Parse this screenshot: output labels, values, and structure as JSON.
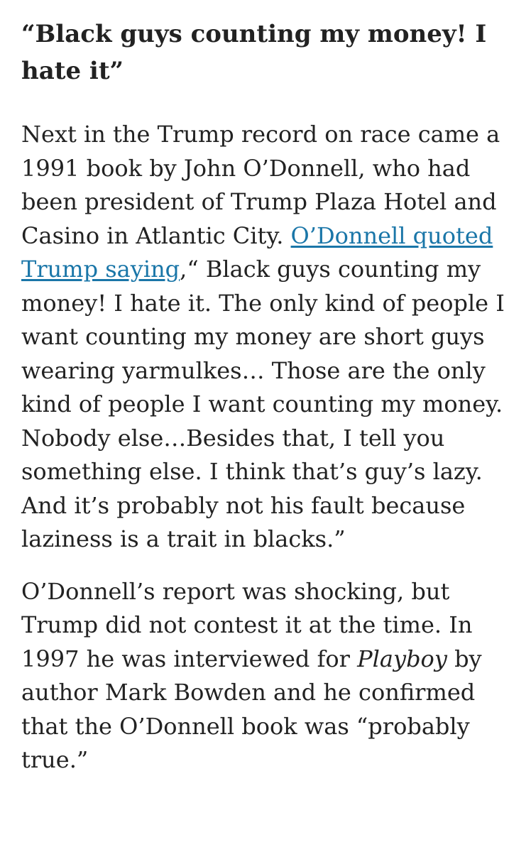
{
  "article": {
    "heading": "“Black guys counting my money! I hate it”",
    "paragraph1": {
      "before_link": "Next in the Trump record on race came a 1991 book by John O’Donnell, who had been president of Trump Plaza Hotel and Casino in Atlantic City. ",
      "link_text": "O’Donnell quoted Trump saying",
      "after_link": ",“ Black guys counting my money! I hate it. The only kind of people I want counting my money are short guys wearing yarmulkes… Those are the only kind of people I want counting my money. Nobody else…Besides that, I tell you something else. I think that’s guy’s lazy. And it’s probably not his fault because laziness is a trait in blacks.”"
    },
    "paragraph2": {
      "before_italic": "O’Donnell’s report was shocking, but Trump did not contest it at the time. In 1997 he was interviewed for ",
      "italic_text": "Playboy",
      "after_italic": " by author Mark Bowden and he confirmed that the O’Donnell book was “probably true.”"
    },
    "colors": {
      "text": "#222222",
      "link": "#1a76a8",
      "background": "#ffffff"
    }
  }
}
